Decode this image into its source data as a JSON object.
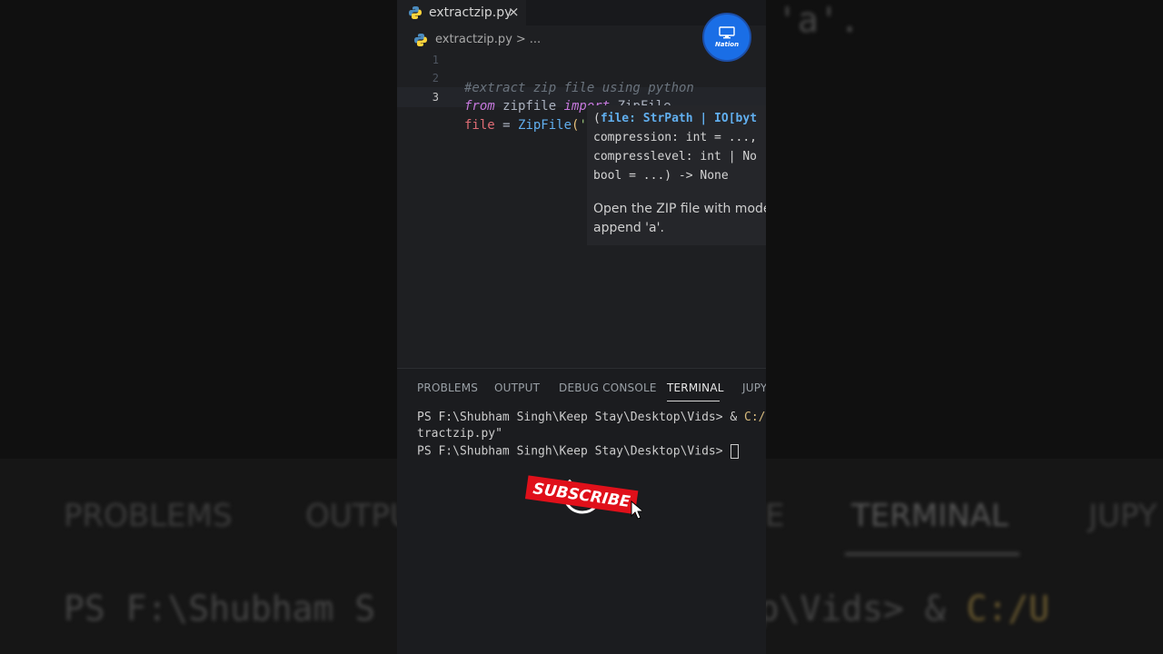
{
  "background": {
    "top_fragment": "'a'.",
    "panel_tabs": [
      "PROBLEMS",
      "OUTPU",
      "E",
      "TERMINAL",
      "JUPY"
    ],
    "terminal_fragment_prefix": "PS F:\\Shubham S",
    "terminal_fragment_path": "sktop\\Vids> & ",
    "terminal_fragment_orange": "C:/U"
  },
  "editor": {
    "tab": {
      "label": "extractzip.py",
      "close_icon": "×"
    },
    "breadcrumb": {
      "file": "extractzip.py",
      "separator": ">",
      "more": "..."
    },
    "lines": [
      {
        "number": "1",
        "comment": "#extract zip file using python"
      },
      {
        "number": "2",
        "kw1": "from",
        "mod": " zipfile ",
        "kw2": "import",
        "name": " ZipFile"
      },
      {
        "number": "3",
        "var": "file",
        "op": " = ",
        "cls": "ZipFile",
        "open": "(",
        "str": "''",
        "close": ")"
      }
    ],
    "hover": {
      "sig_line1_open": "(",
      "sig_line1_param": "file: StrPath | IO[byt",
      "sig_line2": "compression: int = ...,",
      "sig_line3": "compresslevel: int | No",
      "sig_line4": "bool = ...) -> None",
      "doc_line1": "Open the ZIP file with mode",
      "doc_line2": "append 'a'."
    },
    "logo_text": "Nation",
    "colors": {
      "accent": "#1a6ee6",
      "subscribe": "#e0101a"
    }
  },
  "panel": {
    "tabs": [
      "PROBLEMS",
      "OUTPUT",
      "DEBUG CONSOLE",
      "TERMINAL",
      "JUPY"
    ],
    "active_tab": "TERMINAL",
    "terminal": {
      "line1_prompt": "PS F:\\Shubham Singh\\Keep Stay\\Desktop\\Vids> & ",
      "line1_cmd": "C:/U",
      "line2": "tractzip.py\"",
      "line3_prompt": "PS F:\\Shubham Singh\\Keep Stay\\Desktop\\Vids> "
    },
    "subscribe_label": "SUBSCRIBE"
  }
}
